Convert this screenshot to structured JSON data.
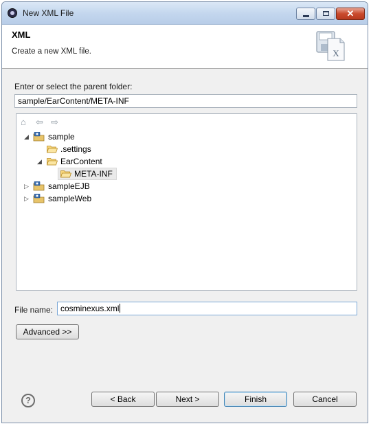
{
  "window": {
    "title": "New XML File",
    "controls": [
      "minimize",
      "maximize",
      "close"
    ],
    "close_glyph": "✕"
  },
  "header": {
    "title": "XML",
    "description": "Create a new XML file.",
    "icon": "xml-file-wizard-icon"
  },
  "folder_section": {
    "label": "Enter or select the parent folder:",
    "value": "sample/EarContent/META-INF"
  },
  "tree": {
    "toolbar_icons": [
      "home-icon",
      "back-arrow-icon",
      "forward-arrow-icon"
    ],
    "items": [
      {
        "label": "sample",
        "type": "project",
        "expanded": true
      },
      {
        "label": ".settings",
        "type": "folder"
      },
      {
        "label": "EarContent",
        "type": "folder",
        "expanded": true
      },
      {
        "label": "META-INF",
        "type": "folder",
        "selected": true
      },
      {
        "label": "sampleEJB",
        "type": "project",
        "expanded": false
      },
      {
        "label": "sampleWeb",
        "type": "project",
        "expanded": false
      }
    ]
  },
  "file_name": {
    "label": "File name:",
    "value": "cosminexus.xml"
  },
  "advanced_button": "Advanced >>",
  "footer": {
    "help_glyph": "?",
    "back": "< Back",
    "next": "Next >",
    "finish": "Finish",
    "cancel": "Cancel"
  },
  "colors": {
    "folder": "#f2c14e",
    "selection": "#eaeaea",
    "default_button_border": "#3c7fb1"
  }
}
